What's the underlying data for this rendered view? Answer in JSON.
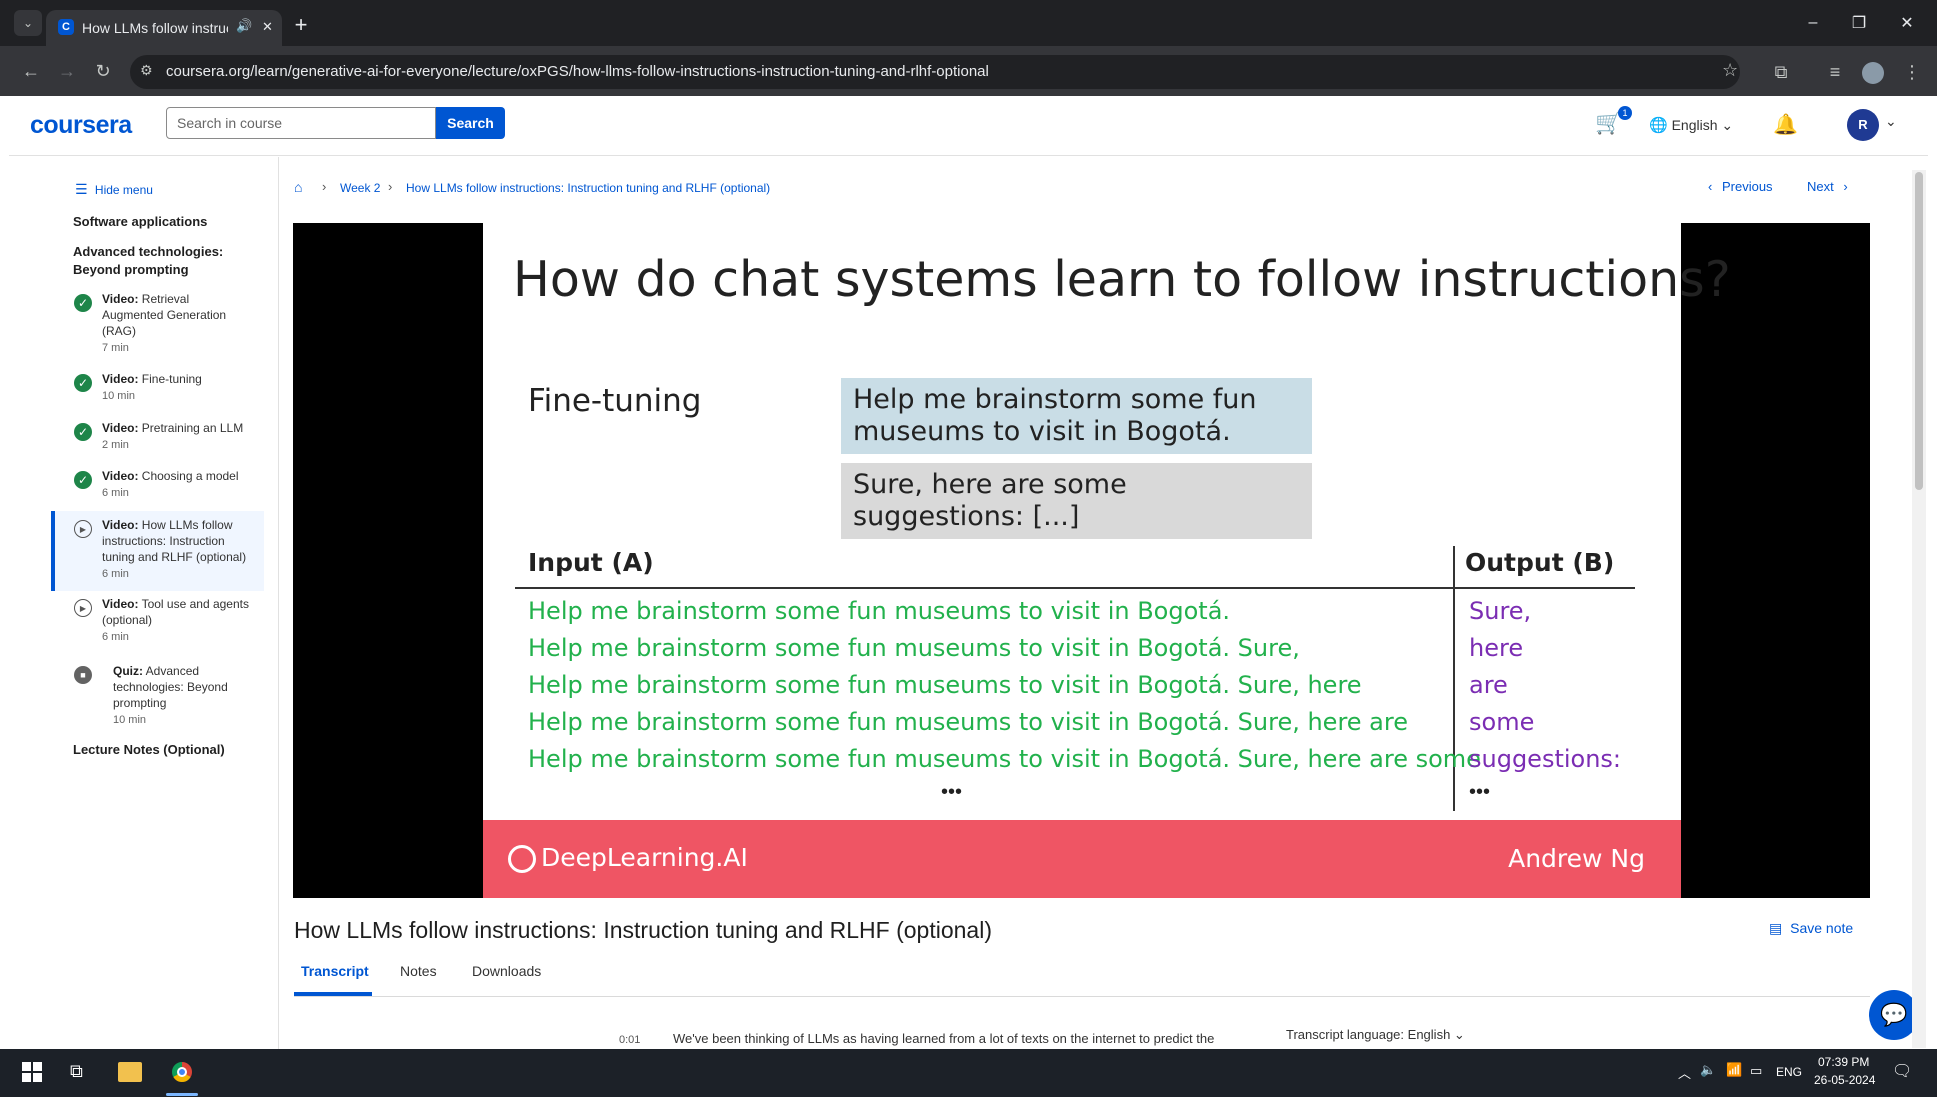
{
  "browser": {
    "tab_title": "How LLMs follow instructio",
    "new_tab": "+",
    "url": "coursera.org/learn/generative-ai-for-everyone/lecture/oxPGS/how-llms-follow-instructions-instruction-tuning-and-rlhf-optional",
    "win_minimize": "–",
    "win_restore": "❐",
    "win_close": "✕"
  },
  "header": {
    "logo": "coursera",
    "search_placeholder": "Search in course",
    "search_button": "Search",
    "cart_count": "1",
    "language": "English",
    "avatar_initial": "R"
  },
  "sidebar": {
    "hide_menu": "Hide menu",
    "section1": "Software applications",
    "section2": "Advanced technologies: Beyond prompting",
    "items": [
      {
        "kind": "Video:",
        "title": "Retrieval Augmented Generation (RAG)",
        "duration": "7 min"
      },
      {
        "kind": "Video:",
        "title": "Fine-tuning",
        "duration": "10 min"
      },
      {
        "kind": "Video:",
        "title": "Pretraining an LLM",
        "duration": "2 min"
      },
      {
        "kind": "Video:",
        "title": "Choosing a model",
        "duration": "6 min"
      },
      {
        "kind": "Video:",
        "title": "How LLMs follow instructions: Instruction tuning and RLHF (optional)",
        "duration": "6 min"
      },
      {
        "kind": "Video:",
        "title": "Tool use and agents (optional)",
        "duration": "6 min"
      },
      {
        "kind": "Quiz:",
        "title": "Advanced technologies: Beyond prompting",
        "duration": "10 min"
      }
    ],
    "lecture_notes": "Lecture Notes (Optional)"
  },
  "breadcrumb": {
    "week": "Week 2",
    "current": "How LLMs follow instructions: Instruction tuning and RLHF (optional)"
  },
  "nav": {
    "previous": "Previous",
    "next": "Next"
  },
  "slide": {
    "title": "How do chat systems learn to follow instructions?",
    "fine_tuning": "Fine-tuning",
    "prompt_box": "Help me brainstorm some fun museums to visit in Bogotá.",
    "response_box": "Sure, here are some suggestions: [...]",
    "input_header": "Input (A)",
    "output_header": "Output (B)",
    "input_rows": [
      "Help me brainstorm some fun museums to visit in Bogotá.",
      "Help me brainstorm some fun museums to visit in Bogotá. Sure,",
      "Help me brainstorm some fun museums to visit in Bogotá. Sure, here",
      "Help me brainstorm some fun museums to visit in Bogotá. Sure, here are",
      "Help me brainstorm some fun museums to visit in Bogotá. Sure, here are some"
    ],
    "output_rows": [
      "Sure,",
      "here",
      "are",
      "some",
      "suggestions:"
    ],
    "ellipsis": "•••",
    "brand": "DeepLearning.AI",
    "instructor": "Andrew Ng"
  },
  "lecture": {
    "title": "How LLMs follow instructions: Instruction tuning and RLHF (optional)",
    "save_note": "Save note",
    "tabs": [
      "Transcript",
      "Notes",
      "Downloads"
    ],
    "transcript_time": "0:01",
    "transcript_text": "We've been thinking of LLMs as having learned from a lot of texts on the internet to predict the",
    "transcript_language_label": "Transcript language:",
    "transcript_language": "English"
  },
  "taskbar": {
    "lang": "ENG",
    "time": "07:39 PM",
    "date": "26-05-2024"
  }
}
